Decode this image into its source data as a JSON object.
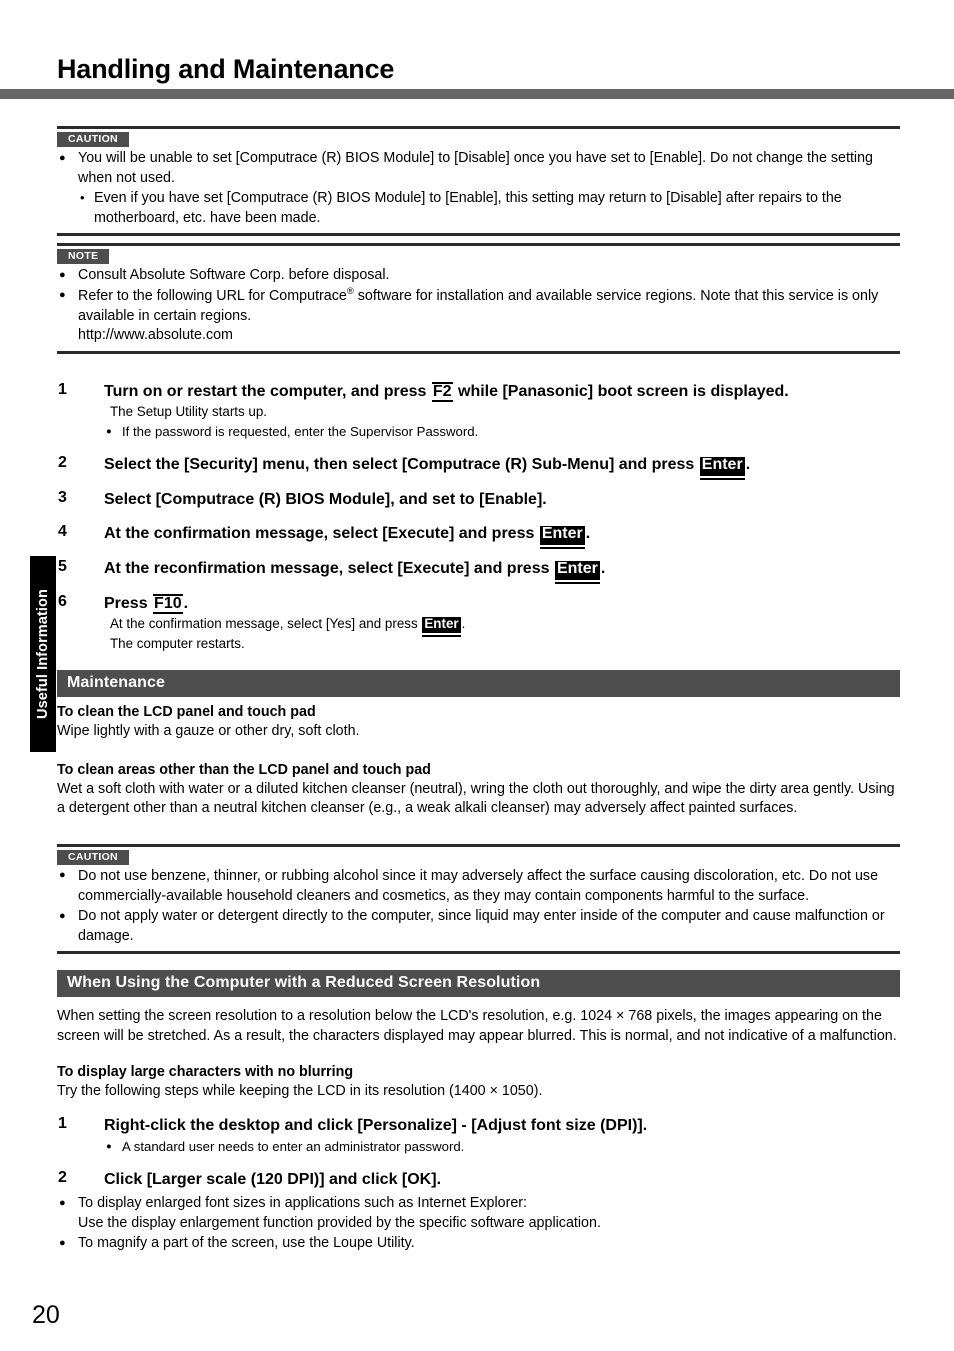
{
  "page": {
    "title": "Handling and Maintenance",
    "number": "20",
    "side_tab": "Useful Information"
  },
  "caution1": {
    "badge": "CAUTION",
    "bullets": [
      "You will be unable to set [Computrace (R) BIOS Module] to [Disable] once you have set to [Enable]. Do not change the setting when not used."
    ],
    "sub_bullets": [
      "Even if you have set [Computrace (R) BIOS Module] to [Enable], this setting may return to [Disable] after repairs to the motherboard, etc. have been made."
    ]
  },
  "note1": {
    "badge": "NOTE",
    "bullet1": "Consult Absolute Software Corp. before disposal.",
    "bullet2_pre": "Refer to the following URL for Computrace",
    "bullet2_sup": "®",
    "bullet2_post": " software for installation and available service regions. Note that this service is only available in certain regions.",
    "bullet2_url": "http://www.absolute.com"
  },
  "steps_bios": [
    {
      "num": "1",
      "text_pre": "Turn on or restart the computer, and press ",
      "key": "F2",
      "key_style": "outline",
      "text_post": " while [Panasonic] boot screen is displayed.",
      "sub_line": "The Setup Utility starts up.",
      "sub_bullet": "If the password is requested, enter the Supervisor Password."
    },
    {
      "num": "2",
      "text_pre": "Select the [Security] menu, then select [Computrace (R) Sub-Menu] and press ",
      "key": "Enter",
      "key_style": "inverted",
      "text_post": "."
    },
    {
      "num": "3",
      "text_pre": "Select [Computrace (R) BIOS Module], and set to [Enable].",
      "key": "",
      "key_style": "none",
      "text_post": ""
    },
    {
      "num": "4",
      "text_pre": "At the confirmation message, select [Execute] and press ",
      "key": "Enter",
      "key_style": "inverted",
      "text_post": "."
    },
    {
      "num": "5",
      "text_pre": "At the reconfirmation message, select [Execute] and press ",
      "key": "Enter",
      "key_style": "inverted",
      "text_post": "."
    },
    {
      "num": "6",
      "text_pre": "Press ",
      "key": "F10",
      "key_style": "outline",
      "text_post": ".",
      "sub_line_pre": "At the confirmation message, select [Yes] and press ",
      "sub_line_key": "Enter",
      "sub_line_post": ".",
      "sub_line2": "The computer restarts."
    }
  ],
  "maintenance": {
    "header": "Maintenance",
    "sub1_head": "To clean the LCD panel and touch pad",
    "sub1_body": "Wipe lightly with a gauze or other dry, soft cloth.",
    "sub2_head": "To clean areas other than the LCD panel and touch pad",
    "sub2_body": "Wet a soft cloth with water or a diluted kitchen cleanser (neutral), wring the cloth out thoroughly, and wipe the dirty area gently.  Using a detergent other than a neutral kitchen cleanser (e.g., a weak alkali cleanser) may adversely affect painted surfaces."
  },
  "caution2": {
    "badge": "CAUTION",
    "bullets": [
      "Do not use benzene, thinner, or rubbing alcohol since it may adversely affect the surface causing discoloration, etc. Do not use commercially-available household cleaners and cosmetics, as they may contain components harmful to the surface.",
      "Do not apply water or detergent directly to the computer, since liquid may enter inside of the computer and cause malfunction or damage."
    ]
  },
  "reduced_res": {
    "header": "When Using the Computer with a Reduced Screen Resolution",
    "body": "When setting the screen resolution to a resolution below the LCD's resolution, e.g. 1024 × 768 pixels, the images appearing on the screen will be stretched. As a result, the characters displayed may appear blurred. This is normal, and not indicative of a malfunction.",
    "sub_head": "To display large characters with no blurring",
    "sub_body": "Try the following steps while keeping the LCD in its resolution (1400 × 1050).",
    "steps": [
      {
        "num": "1",
        "text": "Right-click the desktop and click [Personalize] - [Adjust font size (DPI)].",
        "sub_bullet": "A standard user needs to enter an administrator password."
      },
      {
        "num": "2",
        "text": "Click [Larger scale (120 DPI)] and click [OK]."
      }
    ],
    "tail_bullets": [
      "To display enlarged font sizes in applications such as Internet Explorer:",
      "To magnify a part of the screen, use the Loupe Utility."
    ],
    "tail_cont": "Use the display enlargement function provided by the specific software application."
  }
}
